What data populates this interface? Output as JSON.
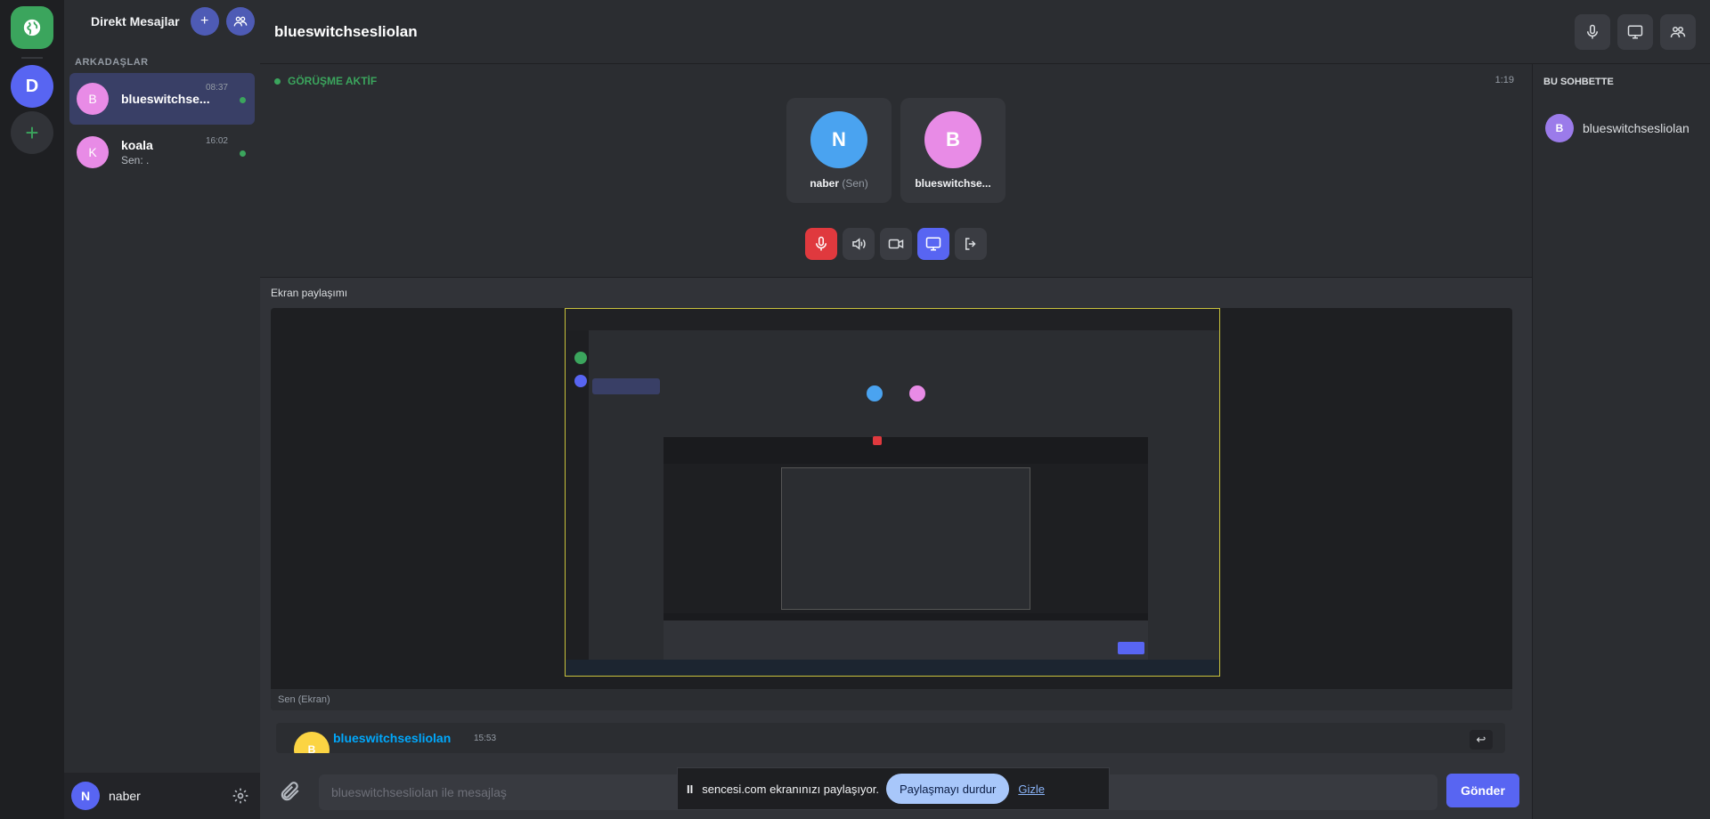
{
  "rail": {
    "home_icon": "globe-icon",
    "server_initial": "D",
    "add_label": "+"
  },
  "dm_sidebar": {
    "title": "Direkt Mesajlar",
    "section_label": "ARKADAŞLAR",
    "items": [
      {
        "initial": "B",
        "name": "blueswitchse...",
        "time": "08:37",
        "preview": "",
        "active": true
      },
      {
        "initial": "K",
        "name": "koala",
        "time": "16:02",
        "preview": "Sen: .",
        "active": false
      }
    ],
    "user": {
      "initial": "N",
      "name": "naber"
    }
  },
  "header": {
    "title": "blueswitchsesliolan"
  },
  "call": {
    "status": "GÖRÜŞME AKTİF",
    "duration": "1:19",
    "participants": [
      {
        "initial": "N",
        "name": "naber",
        "suffix": "(Sen)",
        "color": "#4aa3f0"
      },
      {
        "initial": "B",
        "name": "blueswitchse...",
        "suffix": "",
        "color": "#e88be6"
      }
    ]
  },
  "screen_share": {
    "title": "Ekran paylaşımı",
    "caption": "Sen (Ekran)"
  },
  "messages": [
    {
      "initial": "B",
      "author": "blueswitchsesliolan",
      "time": "15:53"
    }
  ],
  "composer": {
    "placeholder": "blueswitchsesliolan ile mesajlaş",
    "send_label": "Gönder"
  },
  "share_bar": {
    "pause_glyph": "II",
    "message": "sencesi.com ekranınızı paylaşıyor.",
    "stop_label": "Paylaşmayı durdur",
    "hide_label": "Gizle"
  },
  "members": {
    "title": "BU SOHBETTE",
    "list": [
      {
        "initial": "B",
        "name": "blueswitchsesliolan"
      }
    ]
  },
  "colors": {
    "accent": "#5865f2",
    "online": "#3ba55d",
    "danger": "#e0393e"
  }
}
